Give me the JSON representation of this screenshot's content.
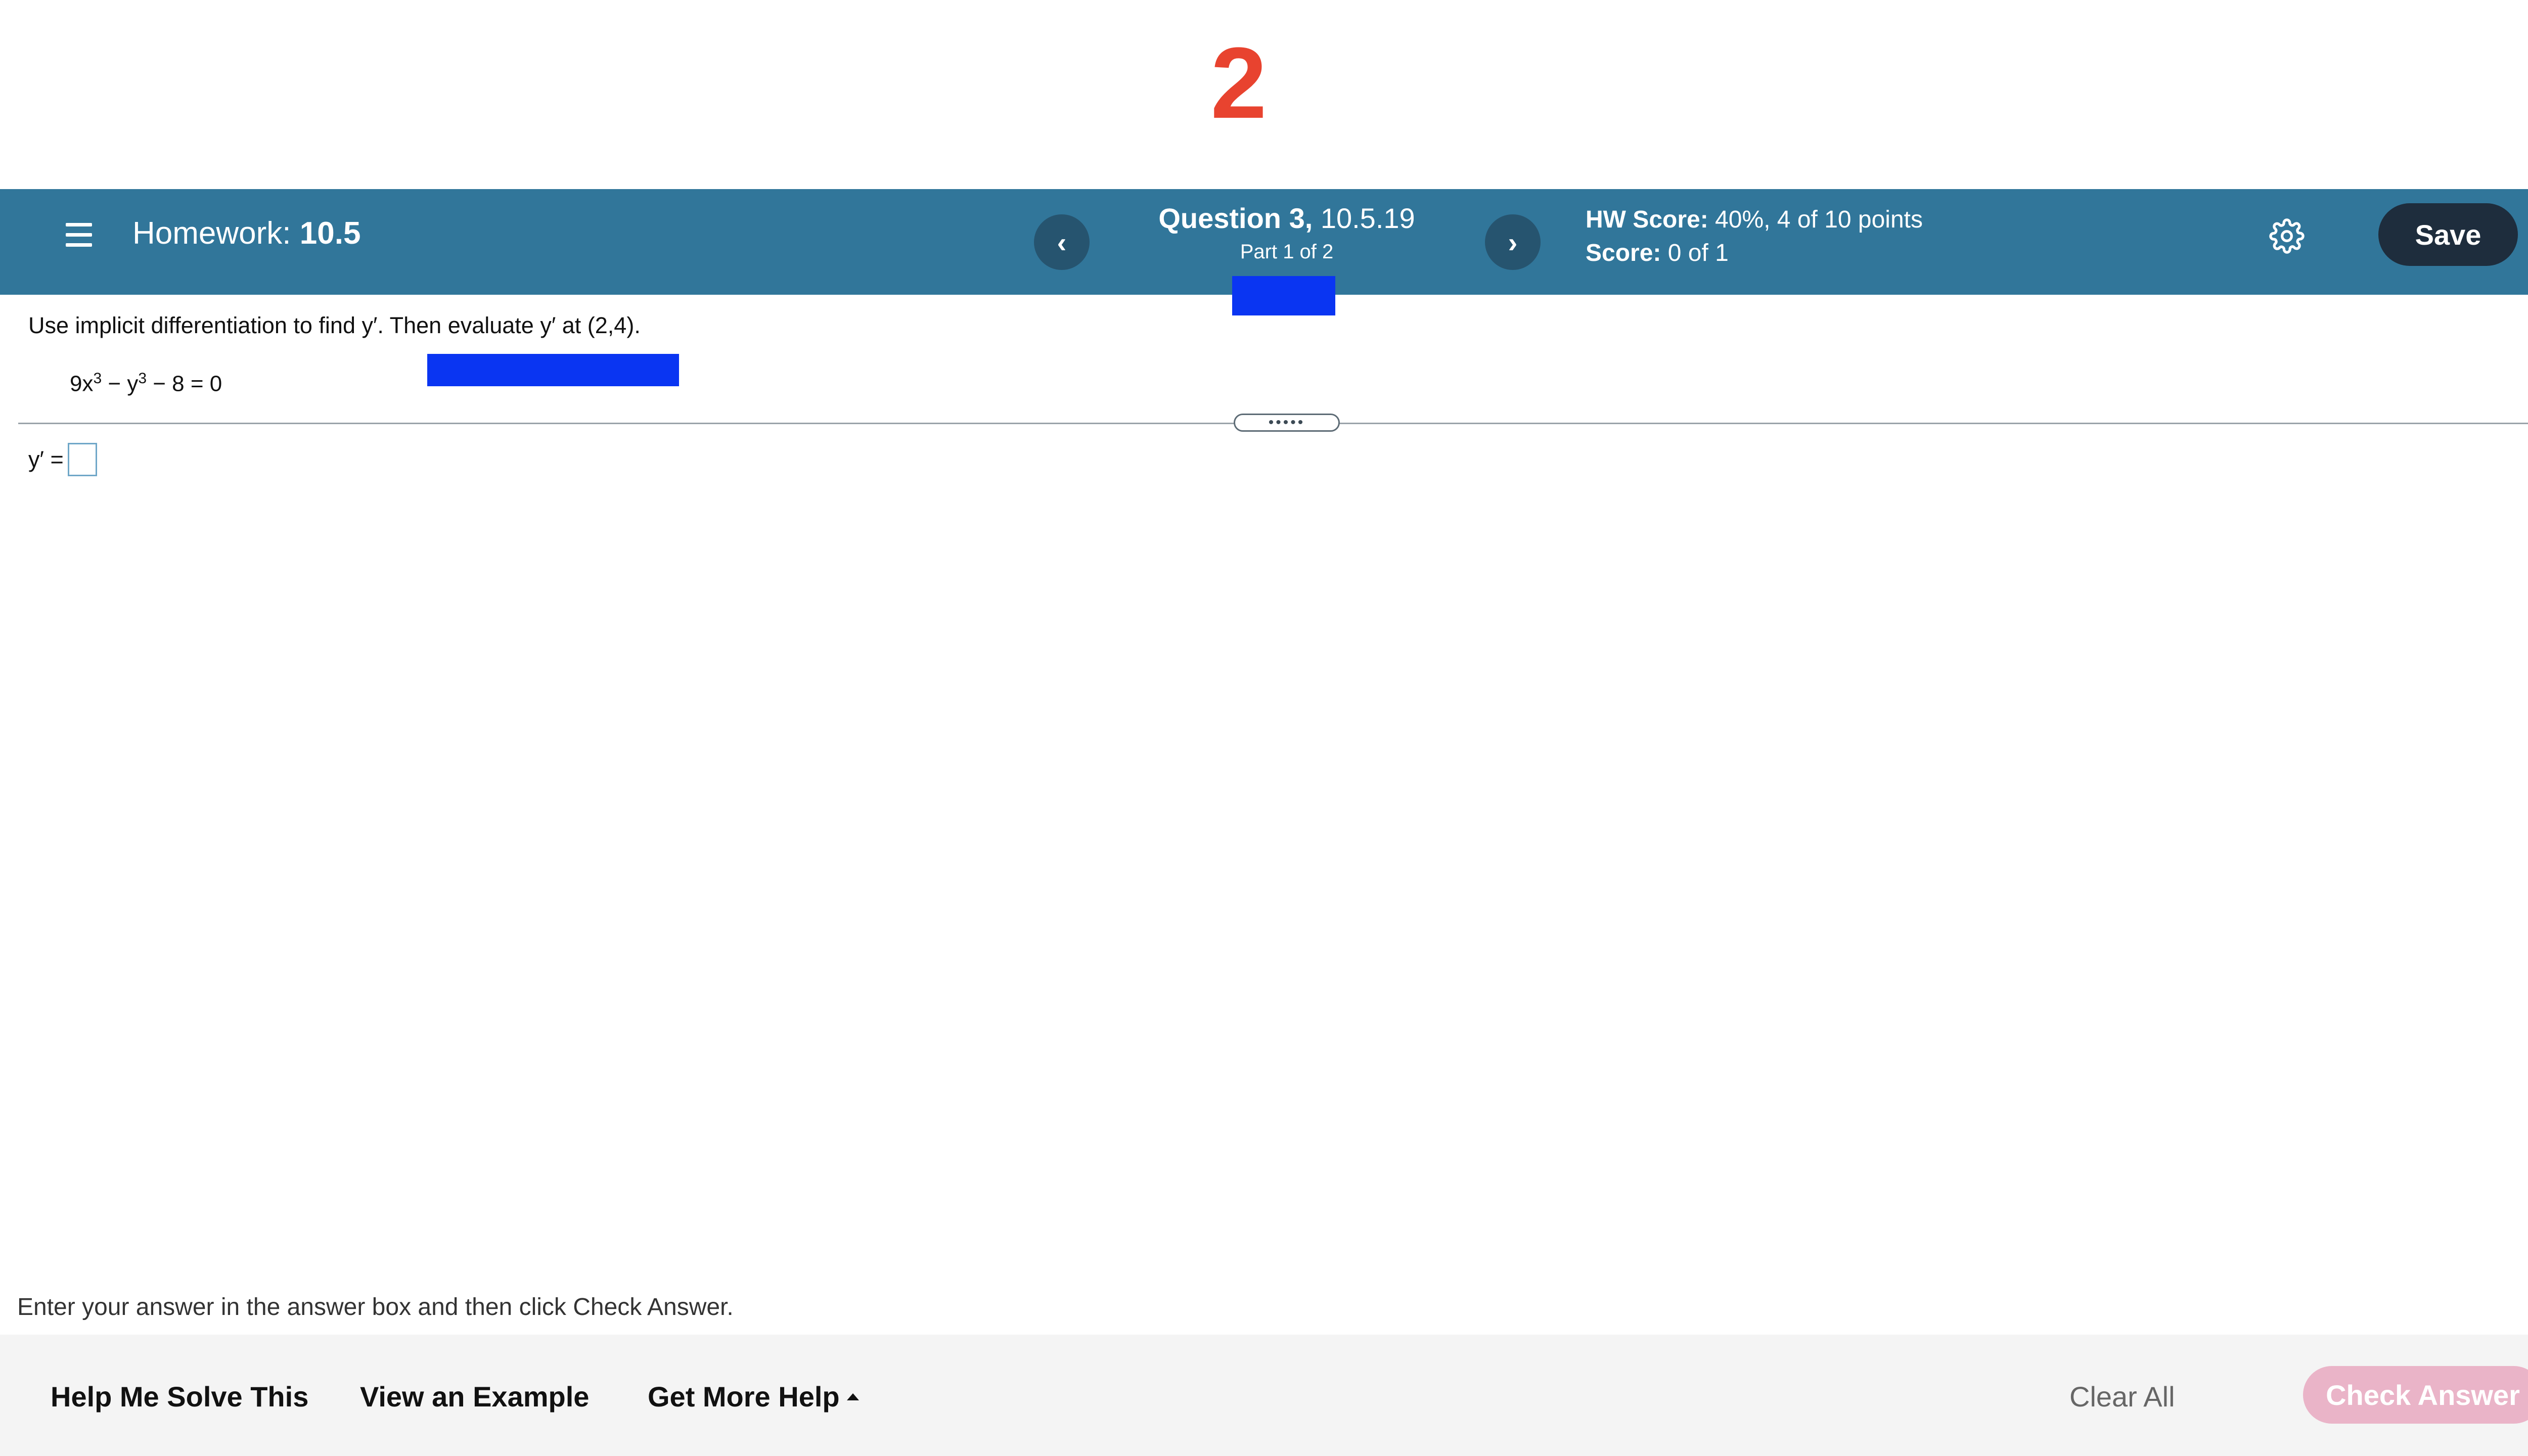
{
  "top_marker": {
    "number": "2"
  },
  "header": {
    "hw_prefix": "Homework:",
    "hw_name": "10.5",
    "prev_glyph": "‹",
    "next_glyph": "›",
    "question_label": "Question 3,",
    "question_id": "10.5.19",
    "part": "Part 1 of 2",
    "hw_score_label": "HW Score:",
    "hw_score_value": "40%, 4 of 10 points",
    "score_label": "Score:",
    "score_value": "0 of 1",
    "save_label": "Save"
  },
  "question": {
    "instruction": "Use implicit differentiation to find y′.  Then evaluate y′ at (2,4).",
    "eq_part1": "9x",
    "eq_exp1": "3",
    "eq_part2": " − y",
    "eq_exp2": "3",
    "eq_part3": " − 8 = 0",
    "divider_handle": "•••••",
    "answer_label": "y′ ="
  },
  "footer": {
    "hint": "Enter your answer in the answer box and then click Check Answer.",
    "help_me_solve": "Help Me Solve This",
    "view_example": "View an Example",
    "get_more_help": "Get More Help",
    "clear_all": "Clear All",
    "check_answer": "Check Answer"
  },
  "icons": {
    "menu": "menu-icon",
    "settings": "gear-icon",
    "dropdown": "caret-up-icon"
  },
  "colors": {
    "header_bg": "#31769a",
    "nav_circle": "#26546f",
    "save_button": "#1e2d3d",
    "marker_red": "#e8432f",
    "check_answer_disabled": "#eab4c8",
    "redaction_blue": "#0a35f2"
  }
}
